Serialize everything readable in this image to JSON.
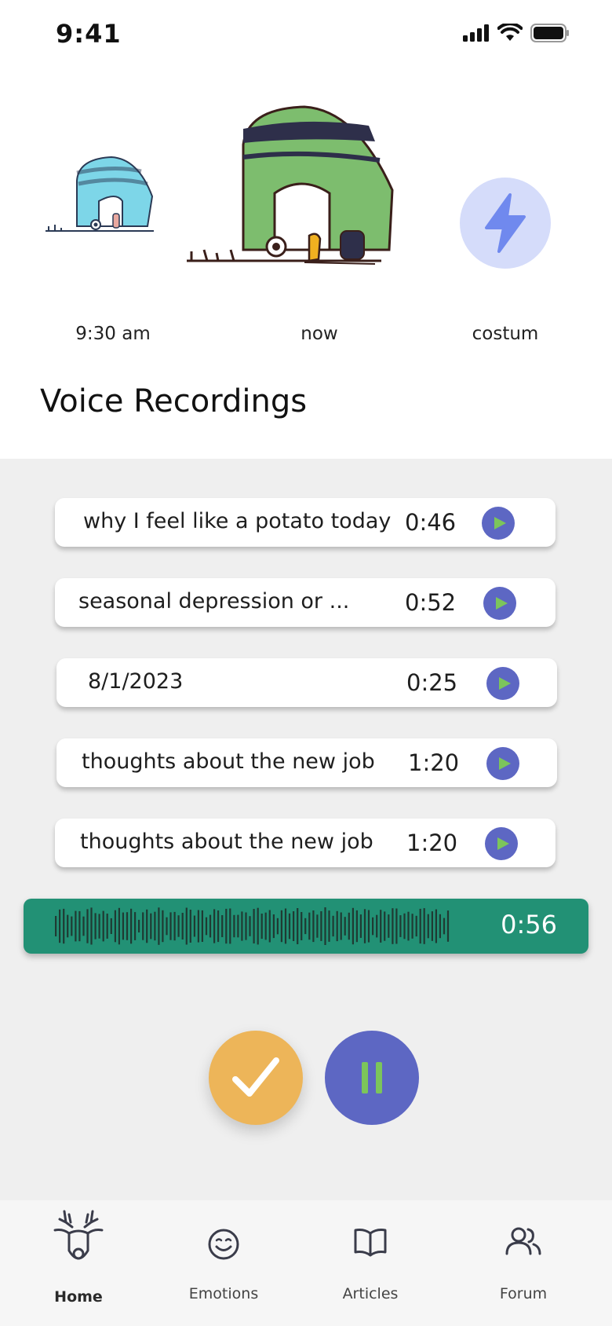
{
  "status_bar": {
    "time": "9:41"
  },
  "moods": [
    {
      "label": "9:30 am"
    },
    {
      "label": "now"
    },
    {
      "label": "costum"
    }
  ],
  "section_title": "Voice Recordings",
  "recordings": [
    {
      "title": "why I feel like a potato today",
      "duration": "0:46"
    },
    {
      "title": "seasonal depression or ...",
      "duration": "0:52"
    },
    {
      "title": "8/1/2023",
      "duration": "0:25"
    },
    {
      "title": "thoughts about the new job",
      "duration": "1:20"
    },
    {
      "title": "thoughts about the new job",
      "duration": "1:20"
    }
  ],
  "recorder": {
    "elapsed": "0:56"
  },
  "tabs": [
    {
      "label": "Home",
      "icon": "deer-icon",
      "active": true
    },
    {
      "label": "Emotions",
      "icon": "smile-icon"
    },
    {
      "label": "Articles",
      "icon": "book-icon"
    },
    {
      "label": "Forum",
      "icon": "users-icon"
    }
  ],
  "colors": {
    "accent": "#5d67c3",
    "play_triangle": "#7cc55b",
    "recorder": "#229175",
    "confirm": "#edb559",
    "background_gray": "#efefef"
  }
}
